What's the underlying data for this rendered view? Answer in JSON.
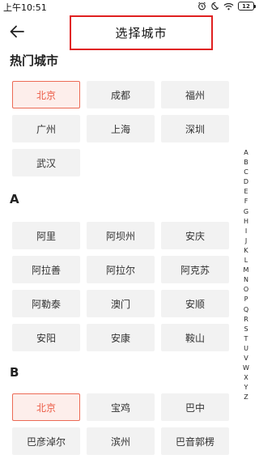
{
  "status_bar": {
    "time": "上午10:51",
    "battery": "12"
  },
  "header": {
    "title": "选择城市"
  },
  "hot": {
    "title": "热门城市",
    "cities": [
      {
        "name": "北京",
        "selected": true
      },
      {
        "name": "成都"
      },
      {
        "name": "福州"
      },
      {
        "name": "广州"
      },
      {
        "name": "上海"
      },
      {
        "name": "深圳"
      },
      {
        "name": "武汉"
      }
    ]
  },
  "sections": [
    {
      "letter": "A",
      "cities": [
        {
          "name": "阿里"
        },
        {
          "name": "阿坝州"
        },
        {
          "name": "安庆"
        },
        {
          "name": "阿拉善"
        },
        {
          "name": "阿拉尔"
        },
        {
          "name": "阿克苏"
        },
        {
          "name": "阿勒泰"
        },
        {
          "name": "澳门"
        },
        {
          "name": "安顺"
        },
        {
          "name": "安阳"
        },
        {
          "name": "安康"
        },
        {
          "name": "鞍山"
        }
      ]
    },
    {
      "letter": "B",
      "cities": [
        {
          "name": "北京",
          "selected": true
        },
        {
          "name": "宝鸡"
        },
        {
          "name": "巴中"
        },
        {
          "name": "巴彦淖尔"
        },
        {
          "name": "滨州"
        },
        {
          "name": "巴音郭楞"
        }
      ]
    }
  ],
  "index_letters": [
    "A",
    "B",
    "C",
    "D",
    "E",
    "F",
    "G",
    "H",
    "I",
    "J",
    "K",
    "L",
    "M",
    "N",
    "O",
    "P",
    "Q",
    "R",
    "S",
    "T",
    "U",
    "V",
    "W",
    "X",
    "Y",
    "Z"
  ]
}
